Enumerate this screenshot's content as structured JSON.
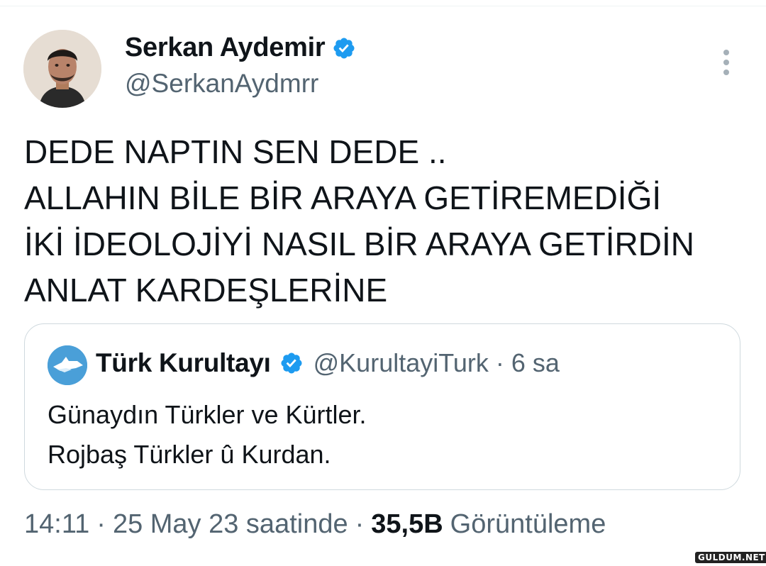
{
  "tweet": {
    "author": {
      "display_name": "Serkan Aydemir",
      "handle": "@SerkanAydmrr",
      "verified_icon": "verified-badge-icon"
    },
    "text_lines": [
      "DEDE NAPTIN SEN DEDE ..",
      "ALLAHIN BİLE BİR ARAYA GETİREMEDİĞİ",
      "İKİ İDEOLOJİYİ NASIL BİR ARAYA GETİRDİN",
      "ANLAT KARDEŞLERİNE"
    ],
    "quoted": {
      "display_name": "Türk Kurultayı",
      "handle": "@KurultayiTurk",
      "separator": "·",
      "time": "6 sa",
      "text_lines": [
        "Günaydın Türkler ve Kürtler.",
        "Rojbaş Türkler û Kurdan."
      ]
    },
    "meta": {
      "time": "14:11",
      "separator": "·",
      "date": "25 May 23 saatinde",
      "views_count": "35,5B",
      "views_label": "Görüntüleme"
    }
  },
  "watermark": "GULDUM.NET",
  "colors": {
    "text_primary": "#0f1419",
    "text_secondary": "#536471",
    "verified_blue": "#1d9bf0",
    "border": "#cfd9de"
  }
}
